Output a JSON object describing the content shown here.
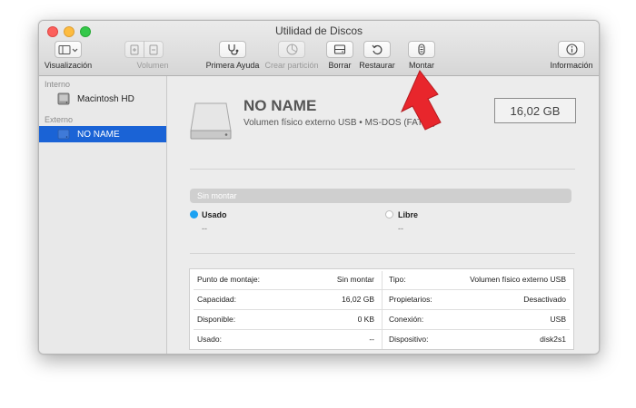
{
  "window": {
    "title": "Utilidad de Discos"
  },
  "toolbar": {
    "view": {
      "label": "Visualización",
      "icon": "sidebar-view-icon"
    },
    "volume": {
      "label": "Volumen",
      "icons": [
        "add-volume-icon",
        "remove-volume-icon"
      ]
    },
    "first_aid": {
      "label": "Primera Ayuda",
      "icon": "stethoscope-icon"
    },
    "partition": {
      "label": "Crear partición",
      "icon": "pie-partition-icon"
    },
    "erase": {
      "label": "Borrar",
      "icon": "erase-icon"
    },
    "restore": {
      "label": "Restaurar",
      "icon": "restore-icon"
    },
    "mount": {
      "label": "Montar",
      "icon": "mount-icon"
    },
    "info": {
      "label": "Información",
      "icon": "info-icon"
    }
  },
  "sidebar": {
    "internal_header": "Interno",
    "external_header": "Externo",
    "items": [
      {
        "label": "Macintosh HD",
        "icon": "internal-disk-icon",
        "selected": false
      },
      {
        "label": "NO NAME",
        "icon": "external-disk-icon",
        "selected": true
      }
    ]
  },
  "disk": {
    "name": "NO NAME",
    "description": "Volumen físico externo USB • MS-DOS (FAT32)",
    "size": "16,02 GB",
    "icon": "external-disk-icon"
  },
  "usage": {
    "bar_label": "Sin montar",
    "used_label": "Usado",
    "used_value": "--",
    "used_color": "#1ba1f2",
    "free_label": "Libre",
    "free_value": "--",
    "free_color": "#ffffff"
  },
  "info_rows": [
    {
      "left_key": "Punto de montaje:",
      "left_value": "Sin montar",
      "right_key": "Tipo:",
      "right_value": "Volumen físico externo USB"
    },
    {
      "left_key": "Capacidad:",
      "left_value": "16,02 GB",
      "right_key": "Propietarios:",
      "right_value": "Desactivado"
    },
    {
      "left_key": "Disponible:",
      "left_value": "0 KB",
      "right_key": "Conexión:",
      "right_value": "USB"
    },
    {
      "left_key": "Usado:",
      "left_value": "--",
      "right_key": "Dispositivo:",
      "right_value": "disk2s1"
    }
  ],
  "colors": {
    "selection": "#1a63d6",
    "arrow": "#e8262c"
  }
}
